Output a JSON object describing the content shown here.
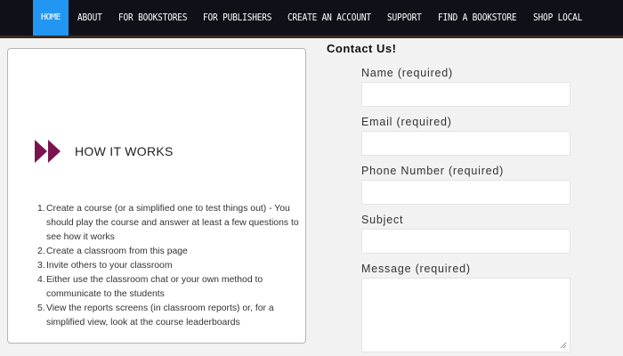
{
  "nav": {
    "items": [
      {
        "label": "HOME"
      },
      {
        "label": "ABOUT"
      },
      {
        "label": "FOR BOOKSTORES"
      },
      {
        "label": "FOR PUBLISHERS"
      },
      {
        "label": "CREATE AN ACCOUNT"
      },
      {
        "label": "SUPPORT"
      },
      {
        "label": "FIND A BOOKSTORE"
      },
      {
        "label": "SHOP LOCAL"
      }
    ],
    "active_color": "#2196f3",
    "background_color": "#101018"
  },
  "how_it_works": {
    "title": "HOW IT WORKS",
    "icon": "double-arrow-icon",
    "icon_color": "#7a1450",
    "steps": [
      {
        "num": "1.",
        "text": "Create a course (or a simplified one to test things out) - You should play the course and answer at least a few questions to see how it works"
      },
      {
        "num": "2.",
        "text": "Create a classroom from this page"
      },
      {
        "num": "3.",
        "text": "Invite others to your classroom"
      },
      {
        "num": "4.",
        "text": "Either use the classroom chat or your own method to communicate to the students"
      },
      {
        "num": "5.",
        "text": "View the reports screens (in classroom reports) or, for a simplified view, look at the course leaderboards"
      }
    ]
  },
  "contact": {
    "title": "Contact Us!",
    "fields": {
      "name": {
        "label": "Name (required)",
        "value": ""
      },
      "email": {
        "label": "Email (required)",
        "value": ""
      },
      "phone": {
        "label": "Phone Number (required)",
        "value": ""
      },
      "subject": {
        "label": "Subject",
        "value": ""
      },
      "message": {
        "label": "Message (required)",
        "value": ""
      }
    }
  }
}
